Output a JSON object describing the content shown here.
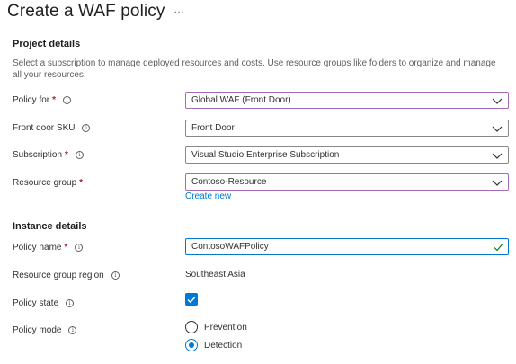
{
  "page": {
    "title": "Create a WAF policy",
    "more_icon": "…"
  },
  "project": {
    "heading": "Project details",
    "description": "Select a subscription to manage deployed resources and costs. Use resource groups like folders to organize and manage all your resources.",
    "policy_for": {
      "label": "Policy for",
      "required": "*",
      "value": "Global WAF (Front Door)"
    },
    "front_door_sku": {
      "label": "Front door SKU",
      "value": "Front Door"
    },
    "subscription": {
      "label": "Subscription",
      "required": "*",
      "value": "Visual Studio Enterprise Subscription"
    },
    "resource_group": {
      "label": "Resource group",
      "required": "*",
      "value": "Contoso-Resource",
      "create_new": "Create new"
    }
  },
  "instance": {
    "heading": "Instance details",
    "policy_name": {
      "label": "Policy name",
      "required": "*",
      "value_before_caret": "ContosoWAF",
      "value_after_caret": "Policy"
    },
    "resource_group_region": {
      "label": "Resource group region",
      "value": "Southeast Asia"
    },
    "policy_state": {
      "label": "Policy state",
      "checked": true
    },
    "policy_mode": {
      "label": "Policy mode",
      "options": [
        "Prevention",
        "Detection"
      ],
      "selected": "Detection"
    }
  },
  "icons": {
    "info": "i",
    "chevron": "chevron-down-icon",
    "check": "checkmark-icon"
  },
  "colors": {
    "accent": "#0078d4",
    "required": "#a4262c",
    "valid": "#107c10",
    "focus_border": "#a869b8"
  }
}
